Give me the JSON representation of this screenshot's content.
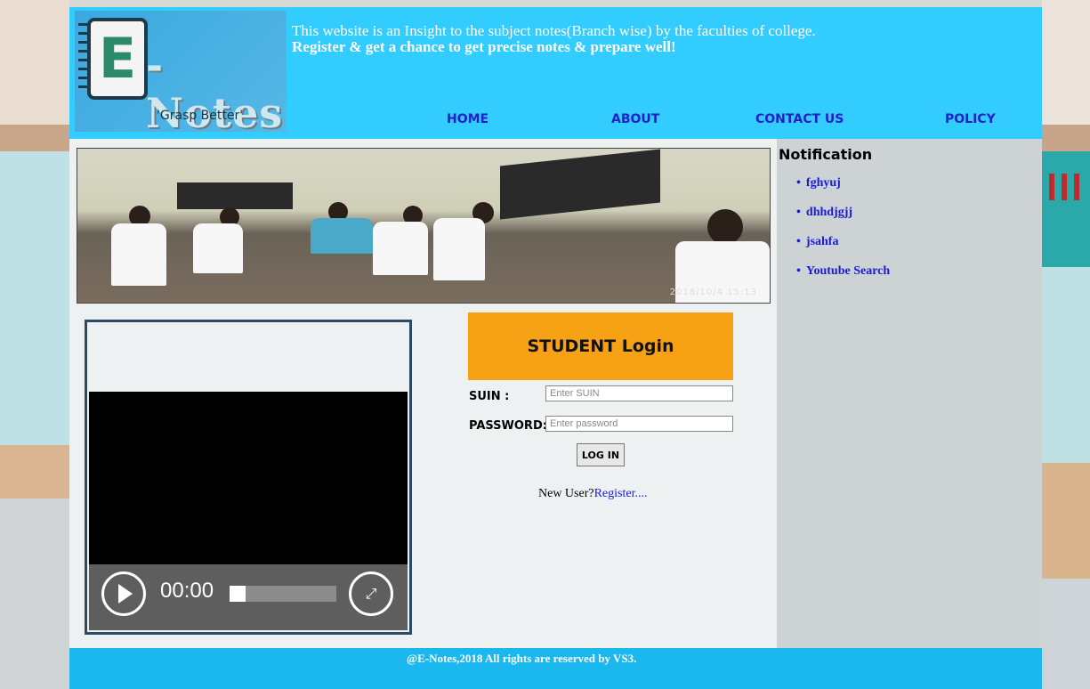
{
  "header": {
    "logo": {
      "letter": "E",
      "name": "-Notes",
      "tagline": "'Grasp Better'"
    },
    "intro_line1": "This website is an Insight to the subject notes(Branch wise) by the faculties of college.",
    "intro_line2": "Register & get a chance to get precise notes & prepare well!",
    "nav": [
      "HOME",
      "ABOUT",
      "CONTACT US",
      "POLICY"
    ]
  },
  "photo": {
    "timestamp": "2018/10/4 15:13"
  },
  "notifications": {
    "title": "Notification",
    "items": [
      "fghyuj",
      "dhhdjgjj",
      "jsahfa",
      "Youtube Search"
    ]
  },
  "video": {
    "time": "00:00",
    "progress": 0.15,
    "play_icon": "play-icon",
    "fullscreen_icon": "fullscreen-icon"
  },
  "login": {
    "title": "STUDENT Login",
    "suin_label": "SUIN :",
    "suin_placeholder": "Enter SUIN",
    "password_label": "PASSWORD:",
    "password_placeholder": "Enter password",
    "button": "LOG IN",
    "new_user": "New User?",
    "register_link": "Register...."
  },
  "footer": {
    "text": "@E-Notes,2018 All rights are reserved by VS3."
  },
  "colors": {
    "header": "#33ccff",
    "login_header": "#f7a215",
    "link": "#1a1adb",
    "footer": "#1bb8f0"
  }
}
